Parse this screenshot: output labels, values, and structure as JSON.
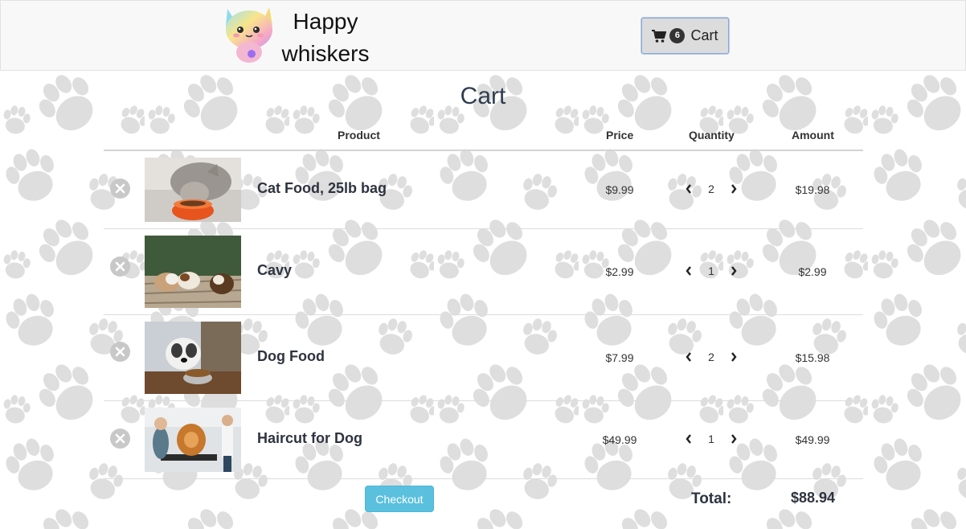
{
  "header": {
    "brand_line1": "Happy",
    "brand_line2": "whiskers",
    "cart_count": "6",
    "cart_label": "Cart"
  },
  "main": {
    "title": "Cart",
    "columns": {
      "product": "Product",
      "price": "Price",
      "quantity": "Quantity",
      "amount": "Amount"
    },
    "items": [
      {
        "name": "Cat Food, 25lb bag",
        "price": "$9.99",
        "quantity": "2",
        "amount": "$19.98"
      },
      {
        "name": "Cavy",
        "price": "$2.99",
        "quantity": "1",
        "amount": "$2.99"
      },
      {
        "name": "Dog Food",
        "price": "$7.99",
        "quantity": "2",
        "amount": "$15.98"
      },
      {
        "name": "Haircut for Dog",
        "price": "$49.99",
        "quantity": "1",
        "amount": "$49.99"
      }
    ],
    "checkout_label": "Checkout",
    "total_label": "Total:",
    "total_value": "$88.94"
  },
  "colors": {
    "accent": "#5bc0de",
    "header_bg": "#f8f8f8",
    "paw": "#e2e2e2"
  },
  "icons": {
    "cart": "shopping-cart-icon",
    "remove": "remove-circle-icon",
    "decrease": "chevron-left-icon",
    "increase": "chevron-right-icon"
  }
}
